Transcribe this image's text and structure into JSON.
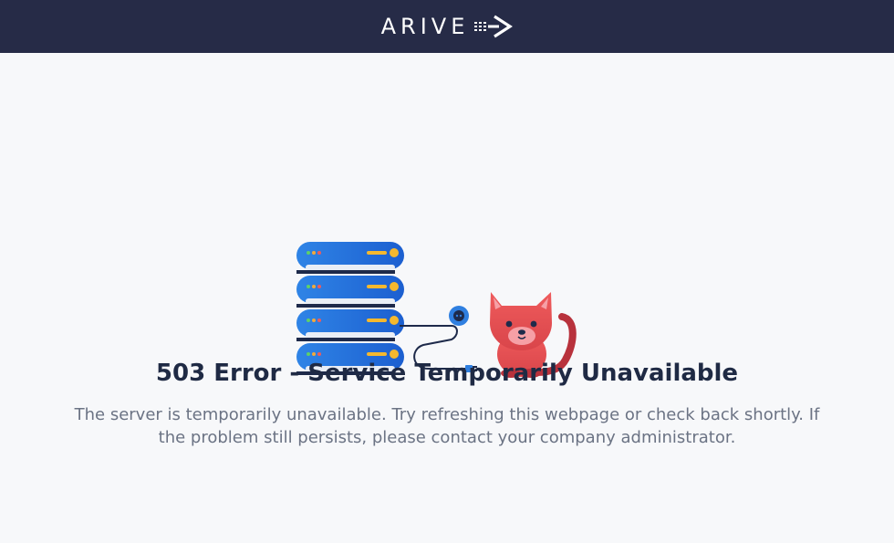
{
  "header": {
    "brand_name": "ARIVE",
    "brand_icon": "arrow-speed-icon",
    "background_color": "#262b47"
  },
  "illustration": {
    "server_icon": "server-stack-icon",
    "cable_icon": "unplugged-cable-icon",
    "cat_icon": "cat-icon",
    "server_color": "#2f7fe0",
    "cat_color": "#e94f52"
  },
  "error": {
    "title": "503 Error - Service Temporarily Unavailable",
    "message": "The server is temporarily unavailable. Try refreshing this webpage or check back shortly. If the problem still persists, please contact your company administrator."
  }
}
